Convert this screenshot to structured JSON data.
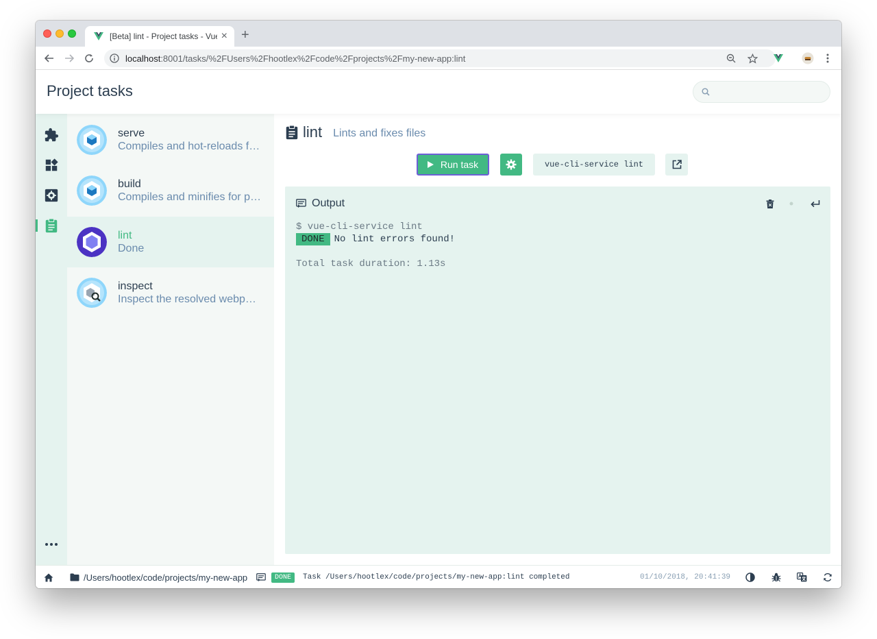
{
  "browser": {
    "tab_title": "[Beta] lint - Project tasks - Vue CLI",
    "tab_close": "×",
    "new_tab": "+",
    "url_host": "localhost",
    "url_rest": ":8001/tasks/%2FUsers%2Fhootlex%2Fcode%2Fprojects%2Fmy-new-app:lint"
  },
  "header": {
    "title": "Project tasks",
    "search_placeholder": ""
  },
  "nav_rail": {
    "items": [
      {
        "name": "plugins",
        "icon": "puzzle-icon"
      },
      {
        "name": "dependencies",
        "icon": "dashboard-icon"
      },
      {
        "name": "configuration",
        "icon": "gear-icon"
      },
      {
        "name": "tasks",
        "icon": "clipboard-icon",
        "active": true
      }
    ],
    "more": "•••"
  },
  "tasks": [
    {
      "name": "serve",
      "description": "Compiles and hot-reloads for development",
      "icon": "webpack-icon"
    },
    {
      "name": "build",
      "description": "Compiles and minifies for production",
      "icon": "webpack-icon"
    },
    {
      "name": "lint",
      "description": "Done",
      "icon": "eslint-icon",
      "selected": true
    },
    {
      "name": "inspect",
      "description": "Inspect the resolved webpack config",
      "icon": "webpack-inspect-icon"
    }
  ],
  "task_detail": {
    "title": "lint",
    "subtitle": "Lints and fixes files",
    "run_label": "Run task",
    "command": "vue-cli-service lint"
  },
  "output": {
    "title": "Output",
    "lines": {
      "prompt": "$ vue-cli-service lint",
      "done_badge": "DONE",
      "done_message": "No lint errors found!",
      "duration": "Total task duration: 1.13s"
    }
  },
  "statusbar": {
    "project_path": "/Users/hootlex/code/projects/my-new-app",
    "log_badge": "DONE",
    "log_message": "Task /Users/hootlex/code/projects/my-new-app:lint completed",
    "timestamp": "01/10/2018, 20:41:39"
  },
  "colors": {
    "accent": "#42b983",
    "rail_bg": "#e5f3ef",
    "text": "#2c3e50",
    "muted": "#6a8bad"
  }
}
